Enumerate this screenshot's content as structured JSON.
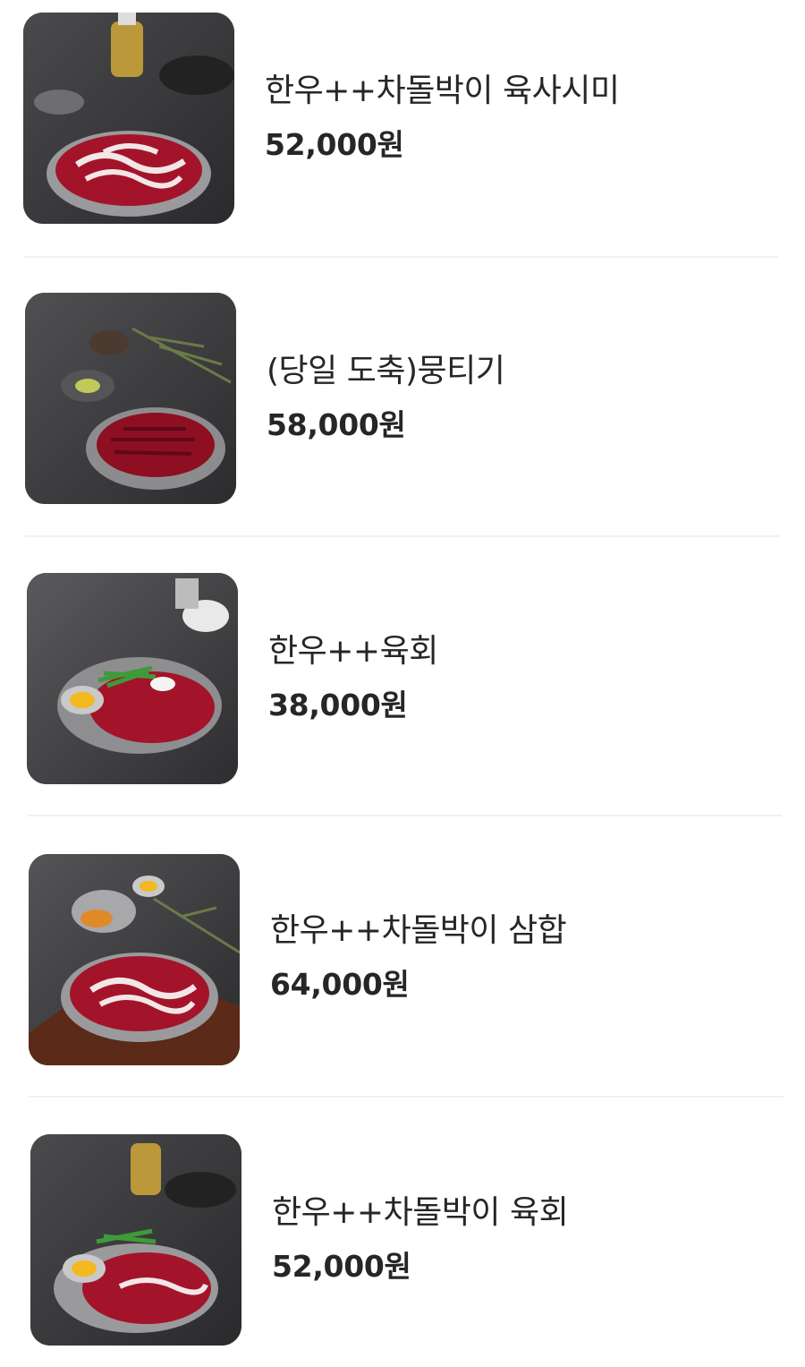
{
  "menu": {
    "items": [
      {
        "name": "한우++차돌박이 육사시미",
        "price": "52,000원",
        "image": "beef-sashimi-photo"
      },
      {
        "name": "(당일 도축)뭉티기",
        "price": "58,000원",
        "image": "mungtigi-photo"
      },
      {
        "name": "한우++육회",
        "price": "38,000원",
        "image": "yukhoe-photo"
      },
      {
        "name": "한우++차돌박이 삼합",
        "price": "64,000원",
        "image": "samhap-photo"
      },
      {
        "name": "한우++차돌박이 육회",
        "price": "52,000원",
        "image": "chadol-yukhoe-photo"
      }
    ]
  },
  "colors": {
    "text": "#262626",
    "divider": "#f1f1f1",
    "meat": "#a3142a",
    "slate": "#3b3b3d"
  }
}
